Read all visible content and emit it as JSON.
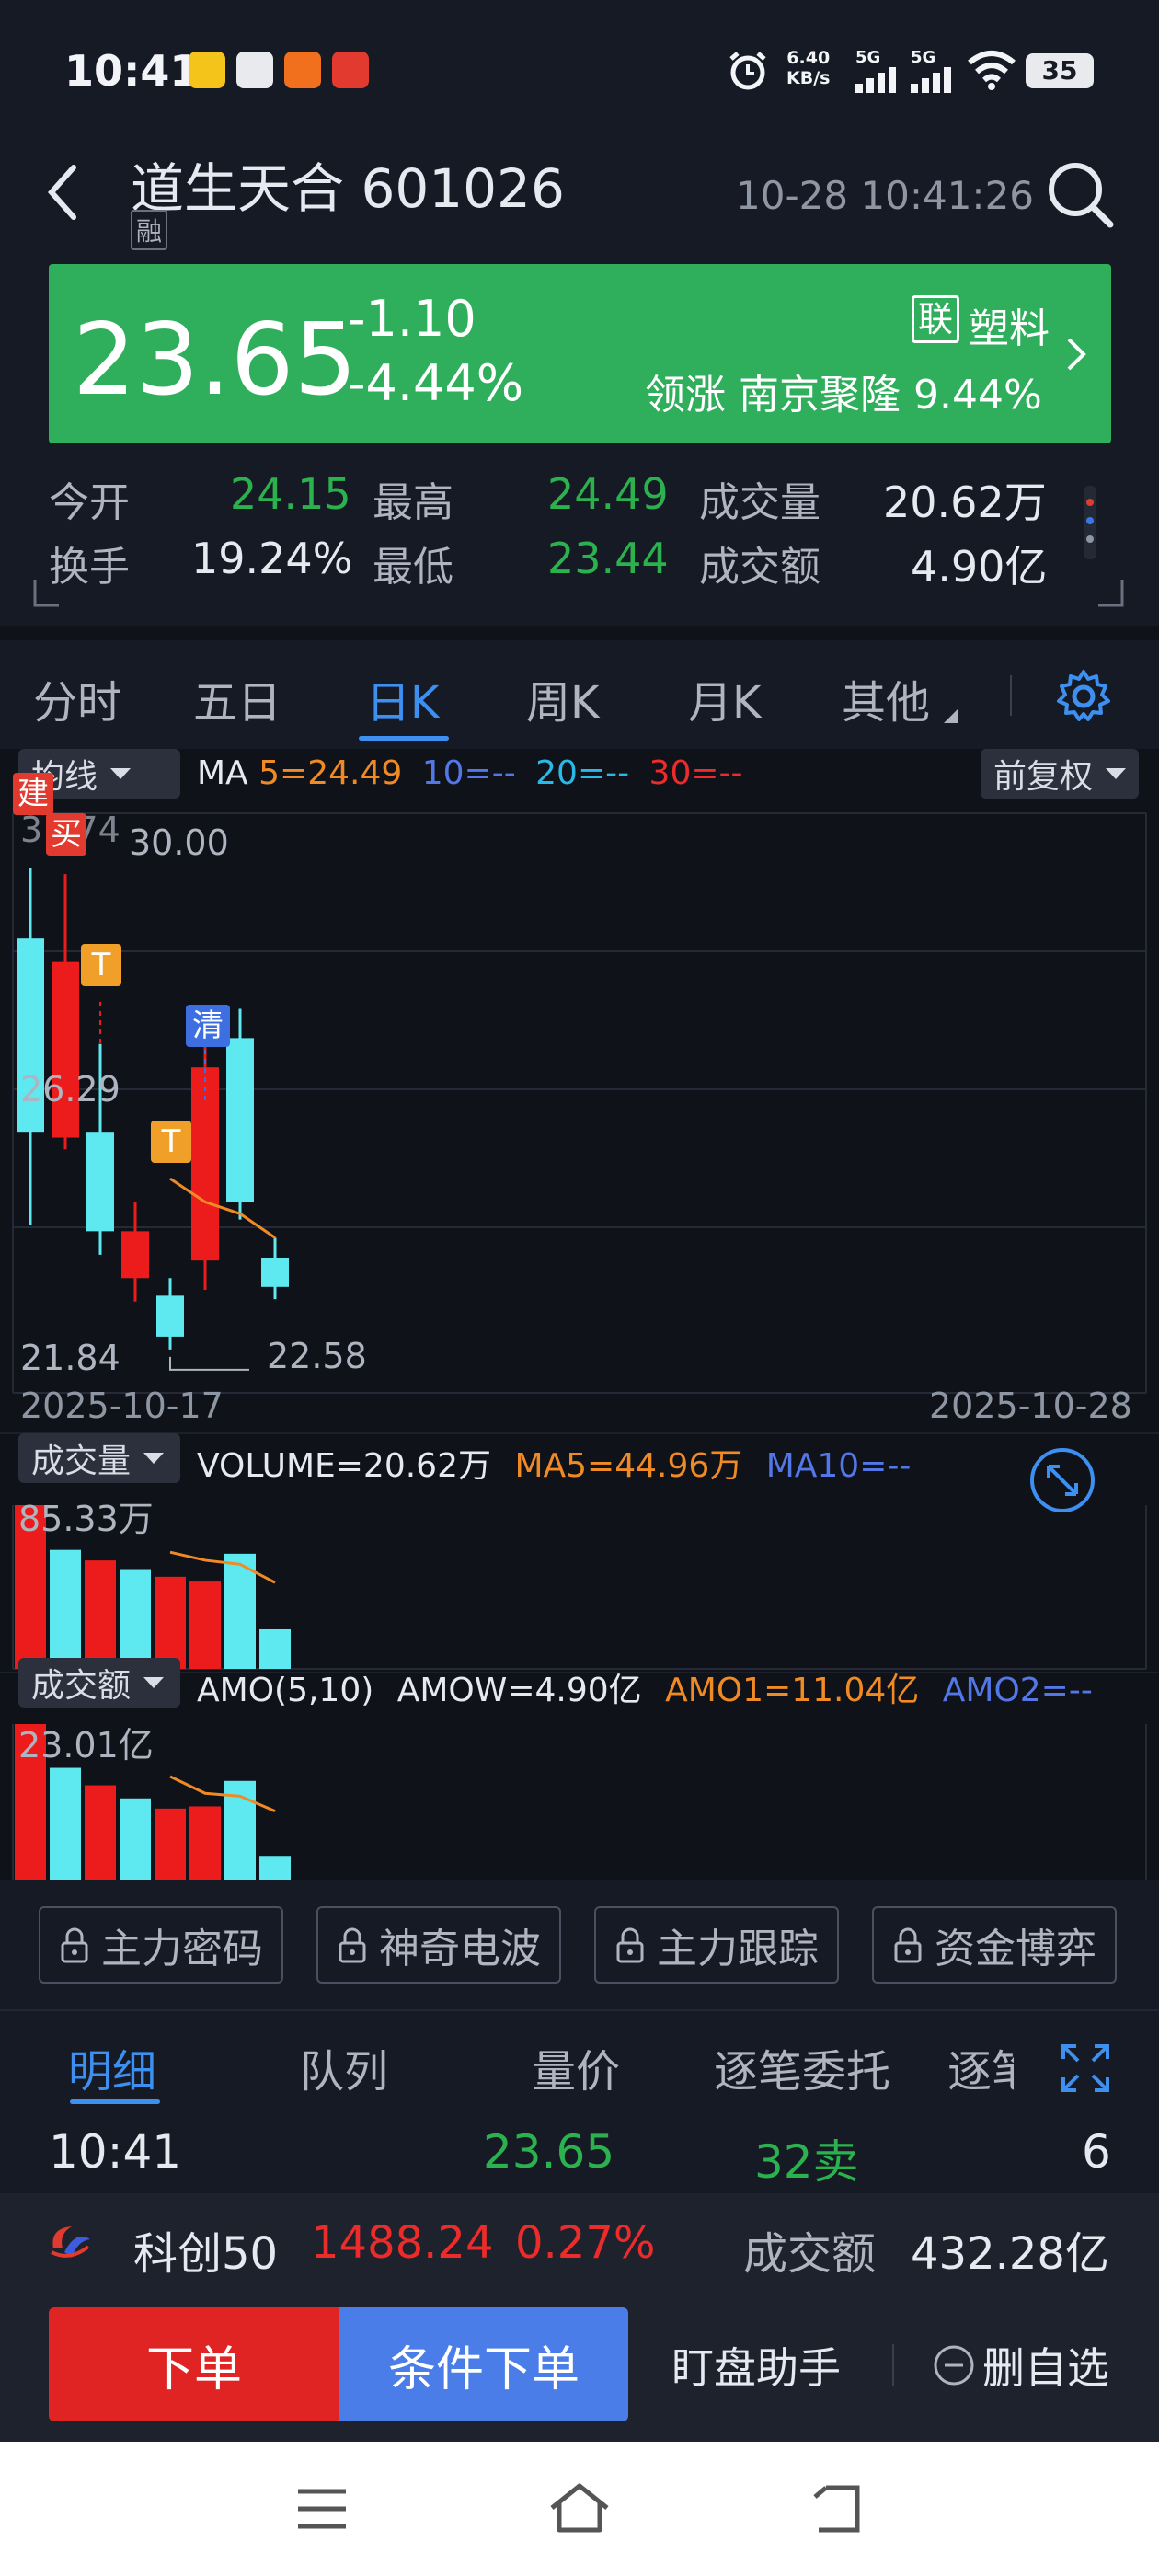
{
  "status_bar": {
    "time": "10:41",
    "speed_top": "6.40",
    "speed_unit": "KB/s",
    "net1": "5G",
    "net2": "5G",
    "battery": "35"
  },
  "header": {
    "stock_name": "道生天合",
    "stock_code": "601026",
    "margin_tag": "融",
    "datetime": "10-28 10:41:26"
  },
  "banner": {
    "price": "23.65",
    "change": "-1.10",
    "change_pct": "-4.44%",
    "sector_tag": "联",
    "sector": "塑料",
    "leader_label": "领涨",
    "leader_name": "南京聚隆",
    "leader_pct": "9.44%",
    "bg_color": "#2fae5c"
  },
  "stats": {
    "open_label": "今开",
    "open": "24.15",
    "high_label": "最高",
    "high": "24.49",
    "vol_label": "成交量",
    "vol": "20.62万",
    "turnover_label": "换手",
    "turnover": "19.24%",
    "low_label": "最低",
    "low": "23.44",
    "amt_label": "成交额",
    "amt": "4.90亿"
  },
  "tabs": {
    "items": [
      "分时",
      "五日",
      "日K",
      "周K",
      "月K",
      "其他"
    ],
    "active": "日K"
  },
  "kline": {
    "ma_dropdown": "均线",
    "ma_label": "MA",
    "ma5": "5=24.49",
    "ma10": "10=--",
    "ma20": "20=--",
    "ma30": "30=--",
    "adjust": "前复权",
    "top_price": "30.00",
    "top_cut": "31.74",
    "mid_price": "26.29",
    "low_price": "21.84",
    "min_mark": "22.58",
    "date_start": "2025-10-17",
    "date_end": "2025-10-28",
    "markers": {
      "jian": "建",
      "mai": "买",
      "t1": "T",
      "qing": "清",
      "t2": "T"
    }
  },
  "chart_data": [
    {
      "type": "candlestick",
      "x": [
        "2025-10-17",
        "2025-10-20",
        "2025-10-21",
        "2025-10-22",
        "2025-10-23",
        "2025-10-24",
        "2025-10-27",
        "2025-10-28"
      ],
      "open": [
        29.6,
        26.2,
        26.3,
        23.8,
        23.5,
        24.1,
        27.9,
        24.15
      ],
      "close": [
        26.3,
        29.2,
        24.6,
        24.6,
        22.8,
        27.4,
        25.1,
        23.65
      ],
      "high": [
        30.8,
        30.7,
        27.8,
        25.1,
        23.8,
        28.2,
        28.4,
        24.49
      ],
      "low": [
        24.7,
        26.0,
        24.2,
        23.4,
        22.58,
        23.6,
        24.8,
        23.44
      ],
      "ma5": [
        null,
        null,
        null,
        null,
        25.5,
        25.1,
        24.9,
        24.49
      ],
      "ylim": [
        21.84,
        31.74
      ]
    },
    {
      "type": "bar",
      "title": "成交量",
      "legend": "VOLUME=20.62万",
      "ma5": "MA5=44.96万",
      "ma10": "MA10=--",
      "max_label": "85.33万",
      "values": [
        85.33,
        62.0,
        56.5,
        52.0,
        48.0,
        45.5,
        60.0,
        20.62
      ],
      "colors": [
        "red",
        "cyan",
        "red",
        "cyan",
        "red",
        "red",
        "cyan",
        "cyan"
      ],
      "ma5_line": [
        null,
        null,
        null,
        null,
        60.8,
        56.6,
        54.5,
        44.96
      ]
    },
    {
      "type": "bar",
      "title": "成交额",
      "legend1": "AMO(5,10)",
      "legend2": "AMOW=4.90亿",
      "amo1": "AMO1=11.04亿",
      "amo2": "AMO2=--",
      "max_label": "23.01亿",
      "values": [
        23.01,
        17.0,
        14.6,
        12.8,
        11.4,
        11.7,
        15.2,
        4.9
      ],
      "colors": [
        "red",
        "cyan",
        "red",
        "cyan",
        "red",
        "red",
        "cyan",
        "cyan"
      ],
      "amo1_line": [
        null,
        null,
        null,
        null,
        15.8,
        13.5,
        13.1,
        11.04
      ]
    }
  ],
  "locks": [
    "主力密码",
    "神奇电波",
    "主力跟踪",
    "资金博弈"
  ],
  "subtabs": {
    "items": [
      "明细",
      "队列",
      "量价",
      "逐笔委托",
      "逐笔"
    ],
    "active": "明细"
  },
  "trade": {
    "time": "10:41",
    "price": "23.65",
    "vol": "32卖",
    "count": "6"
  },
  "index": {
    "name": "科创50",
    "value": "1488.24",
    "pct": "0.27%",
    "amt_label": "成交额",
    "amt": "432.28亿"
  },
  "actions": {
    "order": "下单",
    "cond_order": "条件下单",
    "assistant": "盯盘助手",
    "remove": "删自选"
  }
}
